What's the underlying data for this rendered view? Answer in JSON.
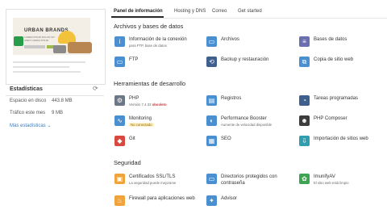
{
  "sidebar": {
    "thumbnail": {
      "brand": "URBAN BRANDS",
      "tagline": "LOREM IPSUM DOLOR SIT AMET LOREM IPSUM"
    },
    "stats_title": "Estadísticas",
    "disk_label": "Espacio en disco",
    "disk_value": "443.8 MB",
    "traffic_label": "Tráfico este mes",
    "traffic_value": "9 MB",
    "more_link": "Más estadísticas"
  },
  "tabs": [
    {
      "label": "Panel de información",
      "active": true
    },
    {
      "label": "Hosting y DNS",
      "active": false
    },
    {
      "label": "Correo",
      "active": false
    },
    {
      "label": "Get started",
      "active": false
    }
  ],
  "sections": {
    "files": {
      "title": "Archivos y bases de datos",
      "items": [
        {
          "label": "Información de la conexión",
          "sub": "para FTP, base de datos",
          "icon": "info-icon"
        },
        {
          "label": "Archivos",
          "icon": "folder-icon"
        },
        {
          "label": "Bases de datos",
          "icon": "database-icon"
        },
        {
          "label": "FTP",
          "icon": "ftp-folder-icon"
        },
        {
          "label": "Backup y restauración",
          "icon": "backup-icon"
        },
        {
          "label": "Copia de sitio web",
          "icon": "website-copy-icon"
        }
      ]
    },
    "dev": {
      "title": "Herramientas de desarrollo",
      "items": [
        {
          "label": "PHP",
          "sub": "Versión 7.4.33",
          "badge": "obsoleto",
          "icon": "php-icon"
        },
        {
          "label": "Registros",
          "icon": "logs-icon"
        },
        {
          "label": "Tareas programadas",
          "icon": "scheduled-tasks-icon"
        },
        {
          "label": "Monitoring",
          "sub_badge": "No conectado",
          "icon": "monitoring-icon"
        },
        {
          "label": "Performance Booster",
          "sub": "Aumente de velocidad disponible",
          "icon": "performance-icon"
        },
        {
          "label": "PHP Composer",
          "icon": "composer-icon"
        },
        {
          "label": "Git",
          "icon": "git-icon"
        },
        {
          "label": "SEO",
          "icon": "seo-icon"
        },
        {
          "label": "Importación de sitios web",
          "icon": "import-icon"
        }
      ]
    },
    "security": {
      "title": "Seguridad",
      "items": [
        {
          "label": "Certificados SSL/TLS",
          "sub": "La seguridad puede mejorarse",
          "icon": "ssl-icon"
        },
        {
          "label": "Directorios protegidos con",
          "label2": "contraseña",
          "icon": "protected-folder-icon"
        },
        {
          "label": "ImunifyAV",
          "sub": "El sitio web está limpio",
          "icon": "imunify-icon"
        },
        {
          "label": "Firewall para aplicaciones web",
          "icon": "firewall-icon"
        },
        {
          "label": "Advisor",
          "icon": "advisor-icon"
        }
      ]
    }
  },
  "colors": {
    "accent": "#3b7dbf",
    "danger": "#d6333b",
    "warning_bg": "#fff1c6"
  }
}
